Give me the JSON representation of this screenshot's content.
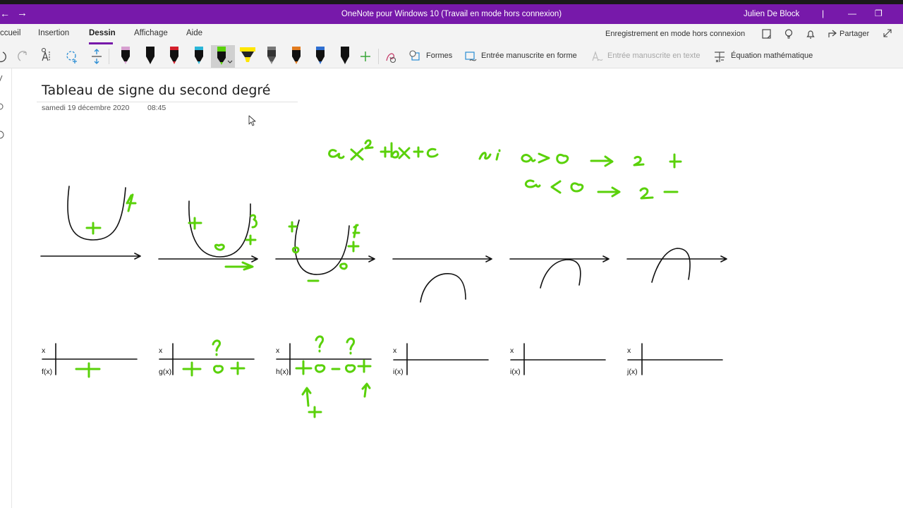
{
  "window": {
    "title": "OneNote pour Windows 10 (Travail en mode hors connexion)",
    "user": "Julien De Block",
    "back_glyph": "←",
    "forward_glyph": "→",
    "minimize_glyph": "—",
    "restore_glyph": "❐",
    "close_glyph": "✕"
  },
  "menu": {
    "tabs": [
      {
        "label": "ccueil"
      },
      {
        "label": "Insertion"
      },
      {
        "label": "Dessin",
        "active": true
      },
      {
        "label": "Affichage"
      },
      {
        "label": "Aide"
      }
    ],
    "status": "Enregistrement en mode hors connexion",
    "share_label": "Partager"
  },
  "toolbar": {
    "shapes_label": "Formes",
    "ink_to_shape_label": "Entrée manuscrite en forme",
    "ink_to_text_label": "Entrée manuscrite en texte",
    "math_label": "Équation mathématique",
    "pens": [
      {
        "name": "pen-pink",
        "color": "#d79fd0"
      },
      {
        "name": "pen-black",
        "color": "#111111"
      },
      {
        "name": "pen-red",
        "color": "#d41f2b"
      },
      {
        "name": "pen-cyan",
        "color": "#2bb6d8"
      },
      {
        "name": "pen-green",
        "color": "#5ad10a",
        "selected": true
      },
      {
        "name": "highlighter-yellow",
        "color": "#ffe600"
      },
      {
        "name": "pen-gray",
        "color": "#8a8a8a"
      },
      {
        "name": "pen-rainbow",
        "color": "#e27b1e"
      },
      {
        "name": "pen-galaxy",
        "color": "#2f6fd1"
      },
      {
        "name": "pen-black-2",
        "color": "#111111"
      }
    ]
  },
  "page": {
    "title": "Tableau de signe du second degré",
    "date": "samedi 19 décembre 2020",
    "time": "08:45"
  },
  "sign_tables": [
    {
      "x_label": "x",
      "fn_label": "f(x)"
    },
    {
      "x_label": "x",
      "fn_label": "g(x)"
    },
    {
      "x_label": "x",
      "fn_label": "h(x)"
    },
    {
      "x_label": "x",
      "fn_label": "i(x)"
    },
    {
      "x_label": "x",
      "fn_label": "i(x)"
    },
    {
      "x_label": "x",
      "fn_label": "j(x)"
    }
  ],
  "colors": {
    "accent": "#7719aa",
    "ink_green": "#5ad10a",
    "ink_black": "#111111"
  }
}
